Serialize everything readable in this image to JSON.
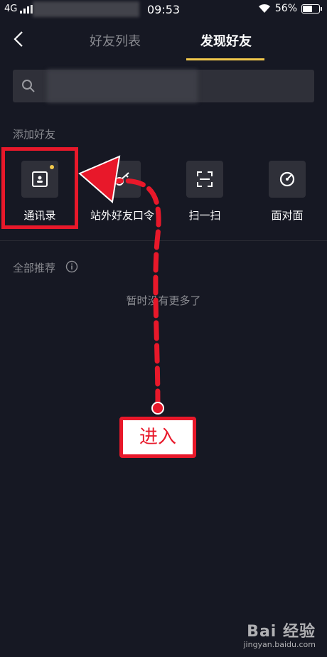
{
  "status_bar": {
    "network": "4G",
    "time": "09:53",
    "battery": "56%",
    "battery_level": 0.56
  },
  "header": {
    "tabs": [
      "好友列表",
      "发现好友"
    ],
    "active_tab": 1
  },
  "search": {
    "placeholder": ""
  },
  "add_friends": {
    "title": "添加好友",
    "items": [
      {
        "label": "通讯录",
        "icon": "contacts-icon",
        "has_dot": true
      },
      {
        "label": "站外好友口令",
        "icon": "key-icon"
      },
      {
        "label": "扫一扫",
        "icon": "scan-icon"
      },
      {
        "label": "面对面",
        "icon": "radar-icon"
      }
    ]
  },
  "recommend": {
    "title": "全部推荐",
    "empty_text": "暂时没有更多了"
  },
  "annotation": {
    "callout_text": "进入",
    "color": "#e8182a"
  },
  "watermark": {
    "brand": "Bai 经验",
    "site": "jingyan.baidu.com"
  },
  "colors": {
    "background": "#161823",
    "accent": "#f2c94c",
    "muted": "#8a8b91"
  }
}
